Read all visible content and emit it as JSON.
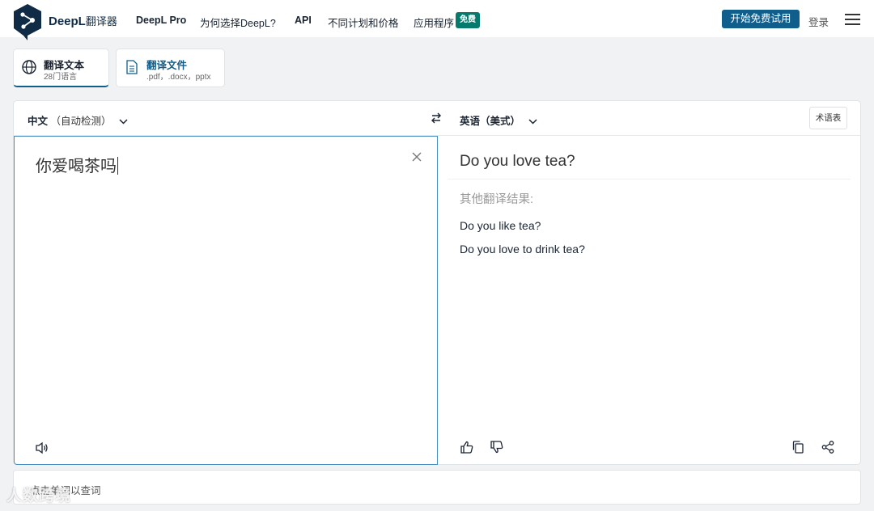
{
  "header": {
    "brand": "DeepL",
    "brand_sub": "翻译器",
    "nav": [
      "DeepL Pro",
      "为何选择DeepL?",
      "API",
      "不同计划和价格",
      "应用程序"
    ],
    "badge": "免费",
    "cta": "开始免费试用",
    "login": "登录"
  },
  "tabs": [
    {
      "title": "翻译文本",
      "subtitle": "28门语言"
    },
    {
      "title": "翻译文件",
      "subtitle": ".pdf，.docx，pptx"
    }
  ],
  "translator": {
    "source_lang": "中文",
    "source_lang_note": "（自动检测）",
    "target_lang": "英语（美式）",
    "glossary": "术语表",
    "source_text": "你爱喝茶吗",
    "target_text": "Do you love tea?",
    "alt_label": "其他翻译结果:",
    "alternatives": [
      "Do you like tea?",
      "Do you love to drink tea?"
    ]
  },
  "dictionary": {
    "hint": "点击单词以查词"
  },
  "watermark": "人数跨境",
  "colors": {
    "brand_dark": "#0f2b46",
    "cta_blue": "#0f5e8c",
    "badge_green": "#067a6d",
    "focus_border": "#4a8fc2"
  }
}
